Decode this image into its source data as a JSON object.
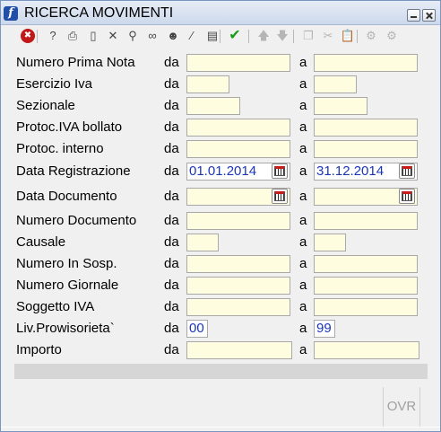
{
  "window": {
    "title": "RICERCA MOVIMENTI"
  },
  "toolbar": {
    "buttons": [
      {
        "name": "stop-icon",
        "glyph": "✖",
        "enabled": true
      },
      {
        "name": "help-pointer-icon",
        "glyph": "?",
        "enabled": true
      },
      {
        "name": "print-icon",
        "glyph": "⎙",
        "enabled": true
      },
      {
        "name": "new-document-icon",
        "glyph": "▯",
        "enabled": true
      },
      {
        "name": "delete-icon",
        "glyph": "✕",
        "enabled": true
      },
      {
        "name": "search-icon",
        "glyph": "⚲",
        "enabled": true
      },
      {
        "name": "binoculars-icon",
        "glyph": "∞",
        "enabled": true
      },
      {
        "name": "user-icon",
        "glyph": "☻",
        "enabled": true
      },
      {
        "name": "magic-wand-icon",
        "glyph": "⁄",
        "enabled": true
      },
      {
        "name": "book-icon",
        "glyph": "▤",
        "enabled": true
      },
      {
        "name": "confirm-check-icon",
        "glyph": "✔",
        "enabled": true
      },
      {
        "name": "arrow-up-icon",
        "glyph": "🡅",
        "enabled": false
      },
      {
        "name": "arrow-down-icon",
        "glyph": "🡇",
        "enabled": false
      },
      {
        "name": "copy-icon",
        "glyph": "❐",
        "enabled": false
      },
      {
        "name": "cut-icon",
        "glyph": "✂",
        "enabled": false
      },
      {
        "name": "paste-icon",
        "glyph": "📋",
        "enabled": false
      },
      {
        "name": "settings-gears-icon",
        "glyph": "⚙",
        "enabled": false
      },
      {
        "name": "settings-gears-2-icon",
        "glyph": "⚙",
        "enabled": false
      }
    ]
  },
  "form": {
    "from_label": "da",
    "to_label": "a",
    "rows": [
      {
        "id": "numero-prima-nota",
        "label": "Numero Prima Nota",
        "from": "",
        "to": ""
      },
      {
        "id": "esercizio-iva",
        "label": "Esercizio Iva",
        "from": "",
        "to": ""
      },
      {
        "id": "sezionale",
        "label": "Sezionale",
        "from": "",
        "to": ""
      },
      {
        "id": "protoc-iva-bollato",
        "label": "Protoc.IVA bollato",
        "from": "",
        "to": ""
      },
      {
        "id": "protoc-interno",
        "label": "Protoc. interno",
        "from": "",
        "to": ""
      },
      {
        "id": "data-registrazione",
        "label": "Data Registrazione",
        "from": "01.01.2014",
        "to": "31.12.2014"
      },
      {
        "id": "data-documento",
        "label": "Data Documento",
        "from": "",
        "to": ""
      },
      {
        "id": "numero-documento",
        "label": "Numero Documento",
        "from": "",
        "to": ""
      },
      {
        "id": "causale",
        "label": "Causale",
        "from": "",
        "to": ""
      },
      {
        "id": "numero-in-sosp",
        "label": "Numero In Sosp.",
        "from": "",
        "to": ""
      },
      {
        "id": "numero-giornale",
        "label": "Numero Giornale",
        "from": "",
        "to": ""
      },
      {
        "id": "soggetto-iva",
        "label": "Soggetto IVA",
        "from": "",
        "to": ""
      },
      {
        "id": "liv-provvisorieta",
        "label": "Liv.Prowisorieta`",
        "from": "00",
        "to": "99"
      },
      {
        "id": "importo",
        "label": "Importo",
        "from": "",
        "to": ""
      }
    ]
  },
  "status": {
    "mode": "OVR"
  }
}
